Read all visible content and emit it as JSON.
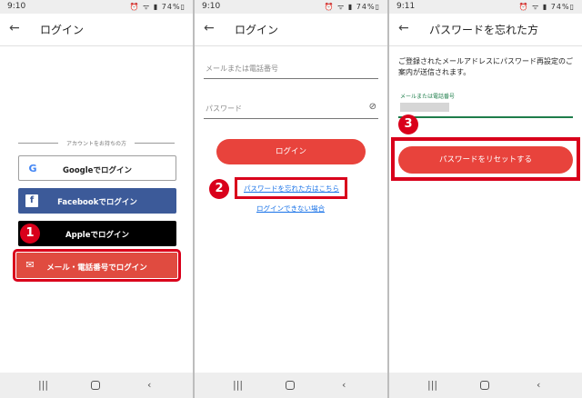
{
  "screens": [
    {
      "status": {
        "time": "9:10",
        "battery": "74%",
        "icons": "⏰ ᯤ ▮ 74%▯"
      },
      "title": "ログイン",
      "divider_text": "アカウントをお持ちの方",
      "buttons": {
        "google": "Googleでログイン",
        "facebook": "Facebookでログイン",
        "apple": "Appleでログイン",
        "email": "メール・電話番号でログイン"
      },
      "step": "1"
    },
    {
      "status": {
        "time": "9:10",
        "icons": "⏰ ᯤ ▮ 74%▯"
      },
      "title": "ログイン",
      "email_placeholder": "メールまたは電話番号",
      "password_placeholder": "パスワード",
      "login_button": "ログイン",
      "forgot_link": "パスワードを忘れた方はこちら",
      "cant_login_link": "ログインできない場合",
      "step": "2"
    },
    {
      "status": {
        "time": "9:11",
        "icons": "⏰ ᯤ ▮ 74%▯"
      },
      "title": "パスワードを忘れた方",
      "description": "ご登録されたメールアドレスにパスワード再設定のご案内が送信されます。",
      "field_label": "メールまたは電話番号",
      "reset_button": "パスワードをリセットする",
      "step": "3"
    }
  ],
  "icons": {
    "back": "arrow-left-icon",
    "google": "google-g-icon",
    "facebook": "facebook-f-icon",
    "apple": "apple-icon",
    "email": "envelope-icon",
    "eye": "eye-off-icon",
    "nav_recent": "recent-apps-icon",
    "nav_home": "home-icon",
    "nav_back": "nav-back-icon"
  },
  "colors": {
    "accent_red": "#e8433c",
    "highlight_red": "#d9001b",
    "facebook_blue": "#3c5a99",
    "green": "#1e7d4a",
    "link_blue": "#1a73e8"
  }
}
